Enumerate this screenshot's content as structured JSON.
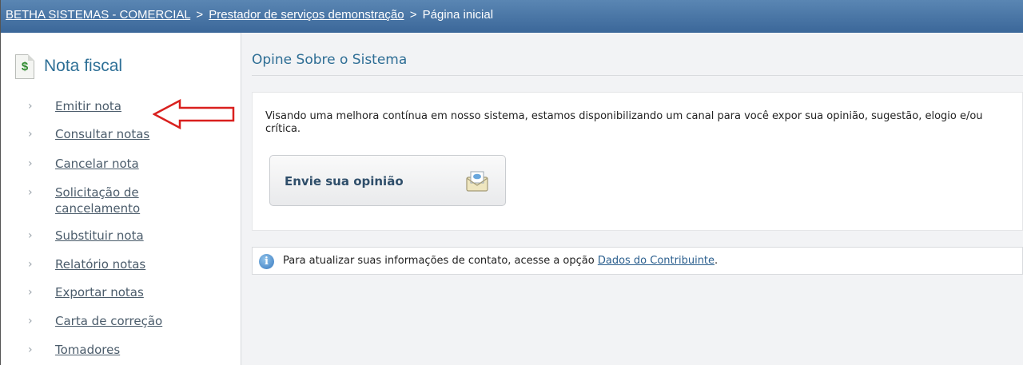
{
  "breadcrumb": {
    "root": "BETHA SISTEMAS - COMERCIAL",
    "separator": ">",
    "provider": "Prestador de serviços demonstração",
    "current": "Página inicial"
  },
  "sidebar": {
    "icon": "dollar-document-icon",
    "icon_glyph": "$",
    "title": "Nota fiscal",
    "chevron": "›",
    "items": [
      {
        "label": "Emitir nota"
      },
      {
        "label": "Consultar notas"
      },
      {
        "label": "Cancelar nota"
      },
      {
        "label": "Solicitação de",
        "label2": "cancelamento"
      },
      {
        "label": "Substituir nota"
      },
      {
        "label": "Relatório notas"
      },
      {
        "label": "Exportar notas"
      },
      {
        "label": "Carta de correção"
      },
      {
        "label": "Tomadores"
      }
    ]
  },
  "annotation": {
    "icon": "red-arrow-icon",
    "color": "#d9201e"
  },
  "main": {
    "title": "Opine Sobre o Sistema",
    "description": "Visando uma melhora contínua em nosso sistema, estamos disponibilizando um canal para você expor sua opinião, sugestão, elogio e/ou crítica.",
    "opinion_button": {
      "label": "Envie sua opinião",
      "icon": "mail-icon"
    },
    "info": {
      "icon": "info-icon",
      "icon_glyph": "i",
      "text": "Para atualizar suas informações de contato, acesse a opção",
      "link": "Dados do Contribuinte",
      "suffix": "."
    }
  },
  "colors": {
    "topbar": "#4a77a6",
    "accent": "#2d6f96",
    "link": "#4b5c6b"
  }
}
